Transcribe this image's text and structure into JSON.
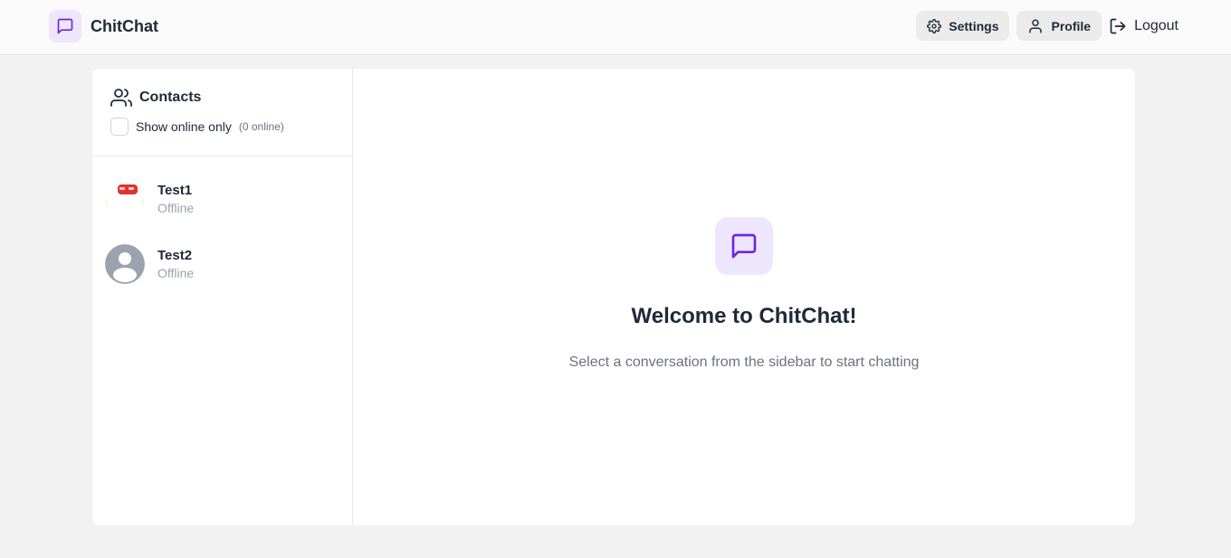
{
  "header": {
    "brand_name": "ChitChat",
    "brand_icon": "message-square-icon",
    "settings_label": "Settings",
    "profile_label": "Profile",
    "logout_label": "Logout"
  },
  "sidebar": {
    "title": "Contacts",
    "show_online_label": "Show online only",
    "online_count": "(0 online)",
    "show_online_checked": false,
    "contacts": [
      {
        "name": "Test1",
        "status": "Offline",
        "avatar": "custom-image"
      },
      {
        "name": "Test2",
        "status": "Offline",
        "avatar": "default-user-avatar"
      }
    ]
  },
  "main": {
    "welcome_title": "Welcome to ChitChat!",
    "welcome_subtitle": "Select a conversation from the sidebar to start chatting"
  },
  "colors": {
    "accent": "#6d28d9",
    "accent_bg": "#ede6fd",
    "page_bg": "#f2f2f2",
    "card_bg": "#ffffff"
  }
}
